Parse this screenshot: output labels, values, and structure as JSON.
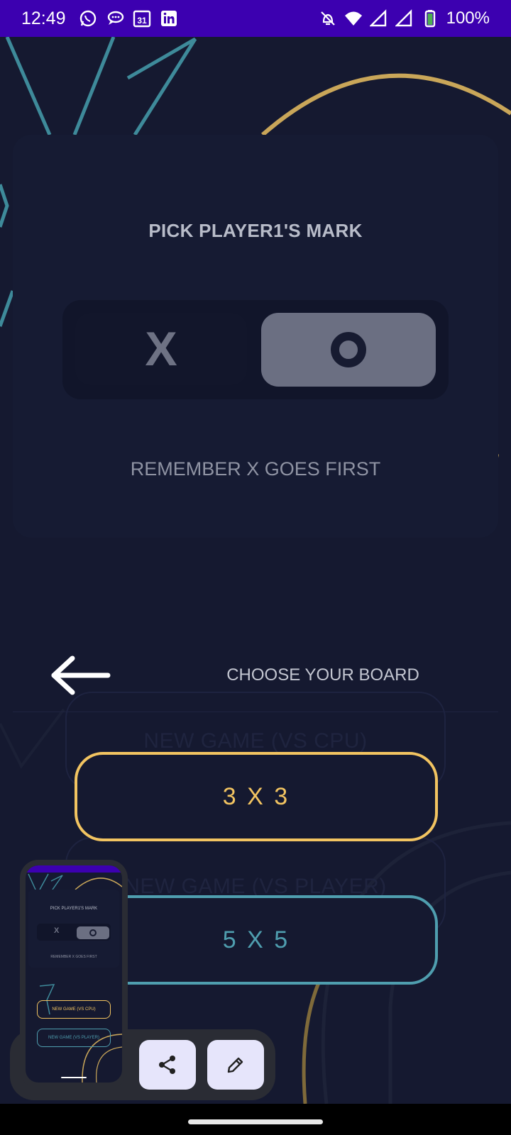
{
  "status_bar": {
    "time": "12:49",
    "battery": "100%",
    "calendar_day": "31",
    "left_icons": [
      "whatsapp-icon",
      "messenger-icon",
      "calendar-icon",
      "linkedin-icon"
    ],
    "right_icons": [
      "do-not-disturb-icon",
      "wifi-icon",
      "signal-icon",
      "signal-icon",
      "battery-icon"
    ]
  },
  "mark_picker": {
    "title": "PICK PLAYER1'S MARK",
    "options": [
      "X",
      "O"
    ],
    "selected": "O",
    "hint": "REMEMBER X GOES FIRST"
  },
  "board_picker": {
    "title": "CHOOSE YOUR BOARD",
    "options": [
      "3 X 3",
      "5 X 5"
    ],
    "ghost_labels": [
      "NEW GAME (VS CPU)",
      "NEW GAME (VS PLAYER)"
    ]
  },
  "screenshot_preview": {
    "title": "PICK PLAYER1'S MARK",
    "mark": "X",
    "hint": "REMEMBER X GOES FIRST",
    "button_cpu": "NEW GAME (VS CPU)",
    "button_player": "NEW GAME (VS PLAYER)"
  },
  "actions": [
    "share-icon",
    "edit-icon"
  ],
  "colors": {
    "background": "#151930",
    "status_bar": "#3c00b0",
    "accent_yellow": "#f2c461",
    "accent_teal": "#4f9eaf",
    "selected_toggle": "#6b6f82"
  }
}
